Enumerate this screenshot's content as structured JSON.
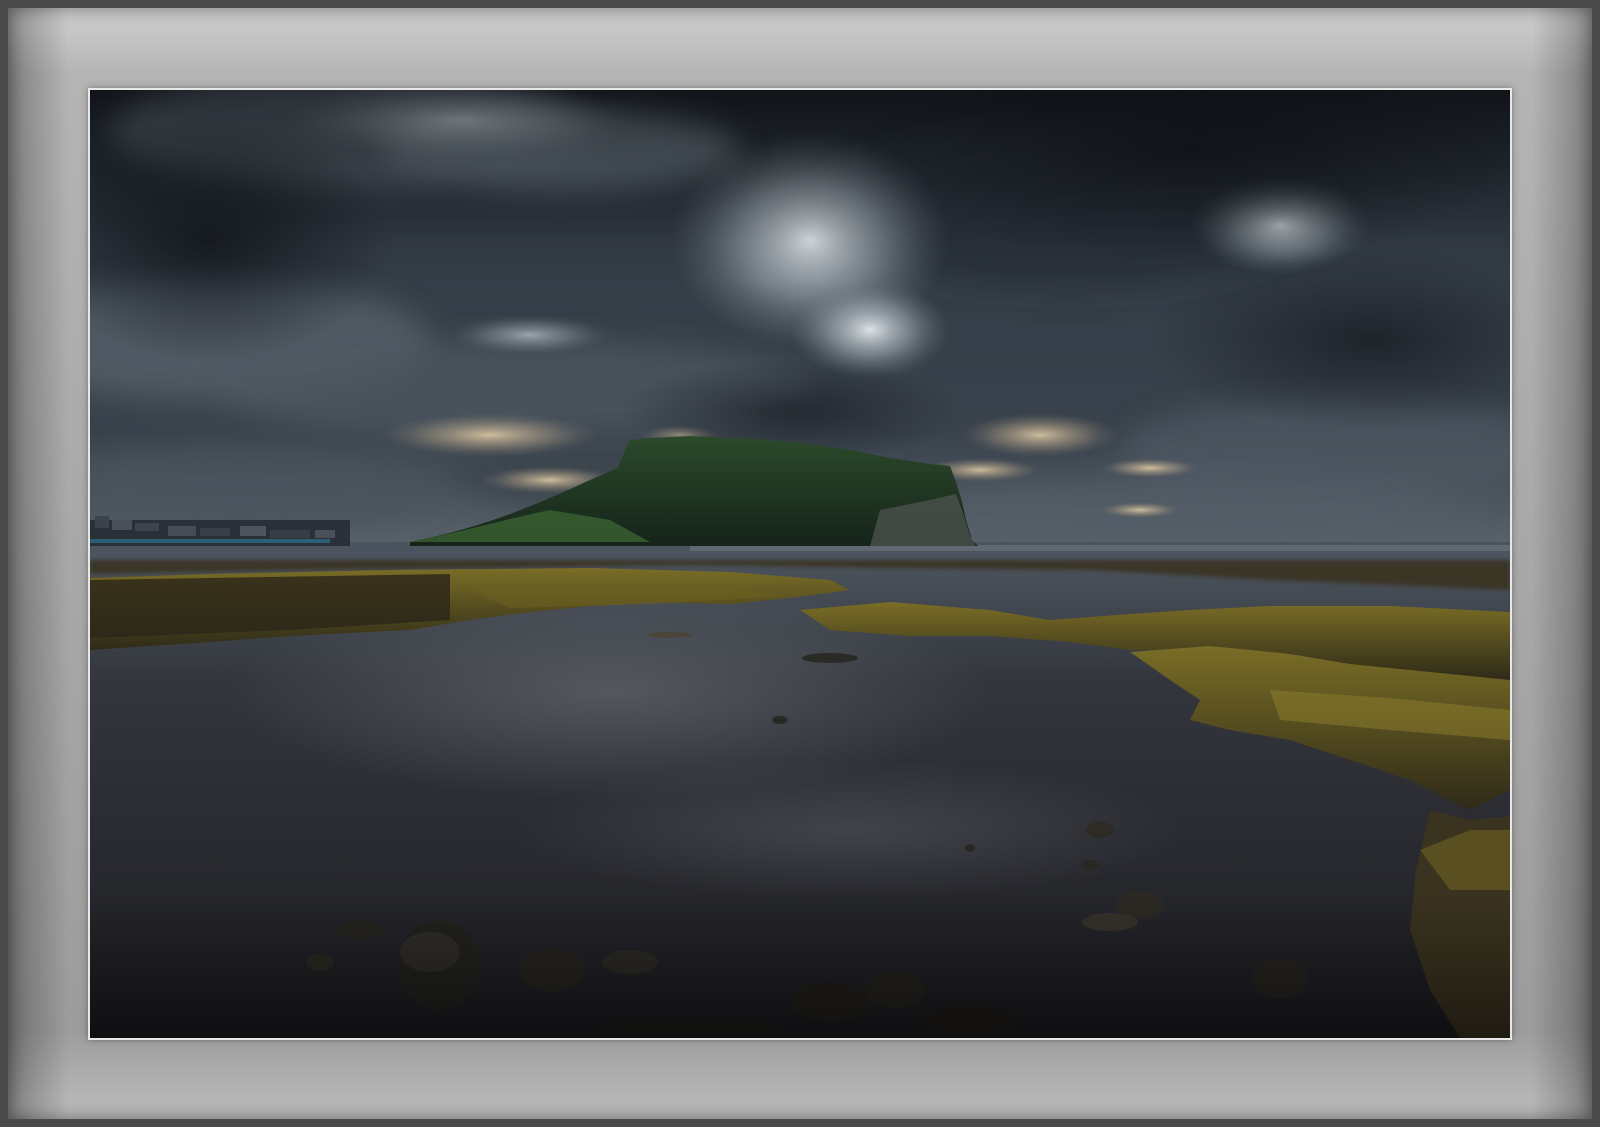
{
  "image": {
    "subject": "",
    "colors": {
      "mat_light": "#d0d0d0",
      "mat_dark": "#9c9c9c",
      "sky_dark": "#1f252d",
      "sky_mid": "#48525c",
      "cloud_light": "#c9d2d8",
      "horizon_glow": "#d9c6a4",
      "headland": "#1f3a22",
      "moss": "#6b6020",
      "water": "#2b2d33"
    }
  }
}
